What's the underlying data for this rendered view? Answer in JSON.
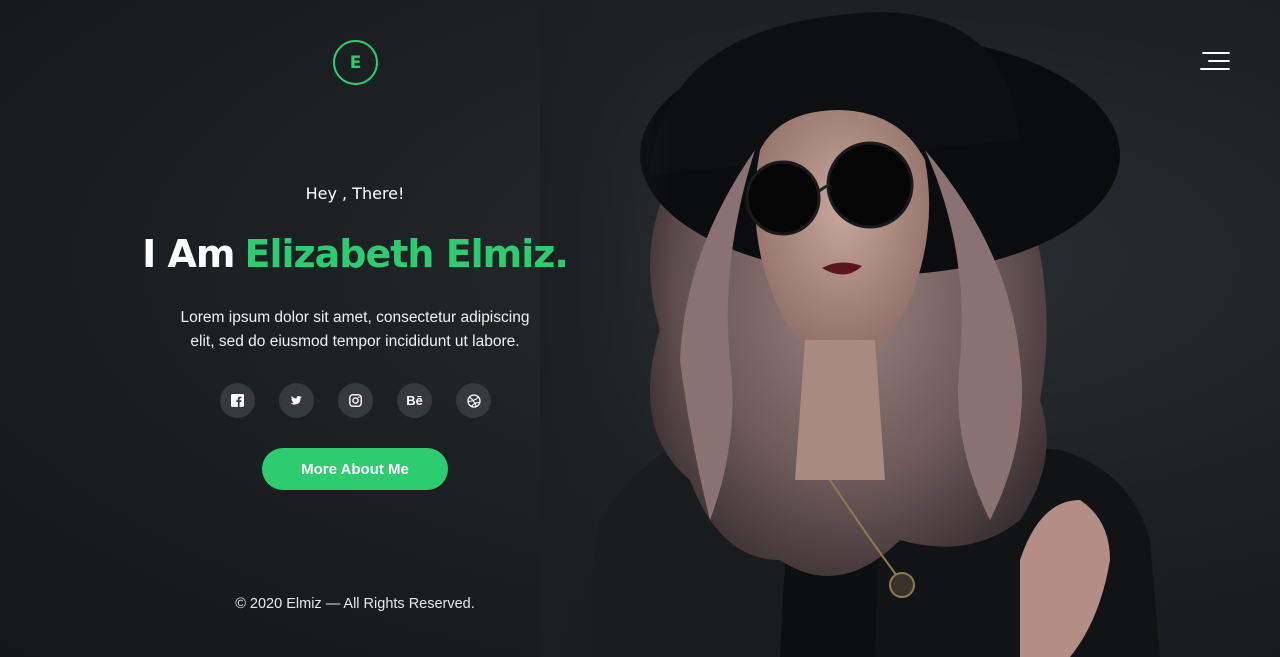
{
  "brand": {
    "logo_letter": "E"
  },
  "hero": {
    "greeting": "Hey , There!",
    "headline_prefix": "I Am",
    "headline_name": "Elizabeth Elmiz.",
    "bio_line1": "Lorem ipsum dolor sit amet, consectetur adipiscing",
    "bio_line2": "elit, sed do eiusmod tempor incididunt ut labore.",
    "cta_label": "More About Me"
  },
  "socials": [
    {
      "icon": "facebook-icon",
      "glyph": "f"
    },
    {
      "icon": "twitter-icon",
      "glyph": ""
    },
    {
      "icon": "instagram-icon",
      "glyph": ""
    },
    {
      "icon": "behance-icon",
      "glyph": "Bē"
    },
    {
      "icon": "dribbble-icon",
      "glyph": ""
    }
  ],
  "footer": {
    "copyright": "© 2020 Elmiz — All Rights Reserved."
  },
  "colors": {
    "accent": "#2ecc71",
    "background": "#1d2124",
    "social_bg": "#353a3d",
    "text": "#ffffff"
  }
}
